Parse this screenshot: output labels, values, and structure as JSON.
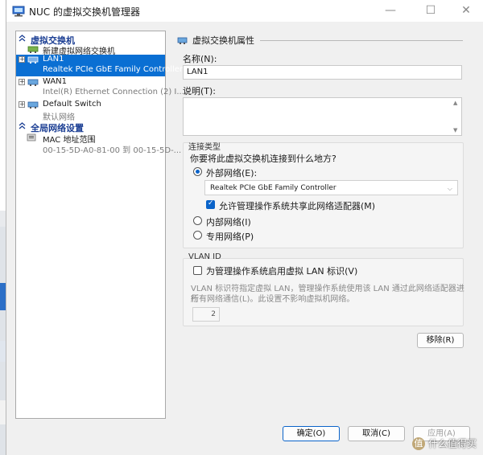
{
  "window": {
    "title": "NUC 的虚拟交换机管理器",
    "minimize": "—",
    "maximize": "☐",
    "close": "✕"
  },
  "bg_strip": {
    "colors": [
      "#ffffff",
      "#2c6fc7",
      "#e5e8ec"
    ]
  },
  "tree": {
    "section_virtual": "虚拟交换机",
    "new_switch": "新建虚拟网络交换机",
    "nodes": [
      {
        "name": "LAN1",
        "sub": "Realtek PCIe GbE Family Controller"
      },
      {
        "name": "WAN1",
        "sub": "Intel(R) Ethernet Connection (2) I..."
      },
      {
        "name": "Default Switch",
        "sub": "默认网络"
      }
    ],
    "section_global": "全局网络设置",
    "mac": {
      "name": "MAC 地址范围",
      "sub": "00-15-5D-A0-81-00 到 00-15-5D-..."
    }
  },
  "props": {
    "header": "虚拟交换机属性",
    "name_label": "名称(N):",
    "name_value": "LAN1",
    "desc_label": "说明(T):",
    "conn_type": "连接类型",
    "conn_question": "你要将此虚拟交换机连接到什么地方?",
    "external": "外部网络(E):",
    "adapter": "Realtek PCIe GbE Family Controller",
    "allow_share": "允许管理操作系统共享此网络适配器(M)",
    "internal": "内部网络(I)",
    "private": "专用网络(P)",
    "vlan_title": "VLAN ID",
    "vlan_check": "为管理操作系统启用虚拟 LAN 标识(V)",
    "vlan_desc_1": "VLAN 标识符指定虚拟 LAN，管理操作系统使用该 LAN 通过此网络适配器进行",
    "vlan_desc_2": "所有网络通信(L)。此设置不影响虚拟机网络。",
    "vlan_value": "2",
    "remove": "移除(R)"
  },
  "footer": {
    "ok": "确定(O)",
    "cancel": "取消(C)",
    "apply": "应用(A)"
  },
  "watermark": {
    "icon": "值",
    "text": "什么值得买"
  },
  "colors": {
    "accent": "#0a6fd3",
    "section_text": "#1c3f94"
  }
}
